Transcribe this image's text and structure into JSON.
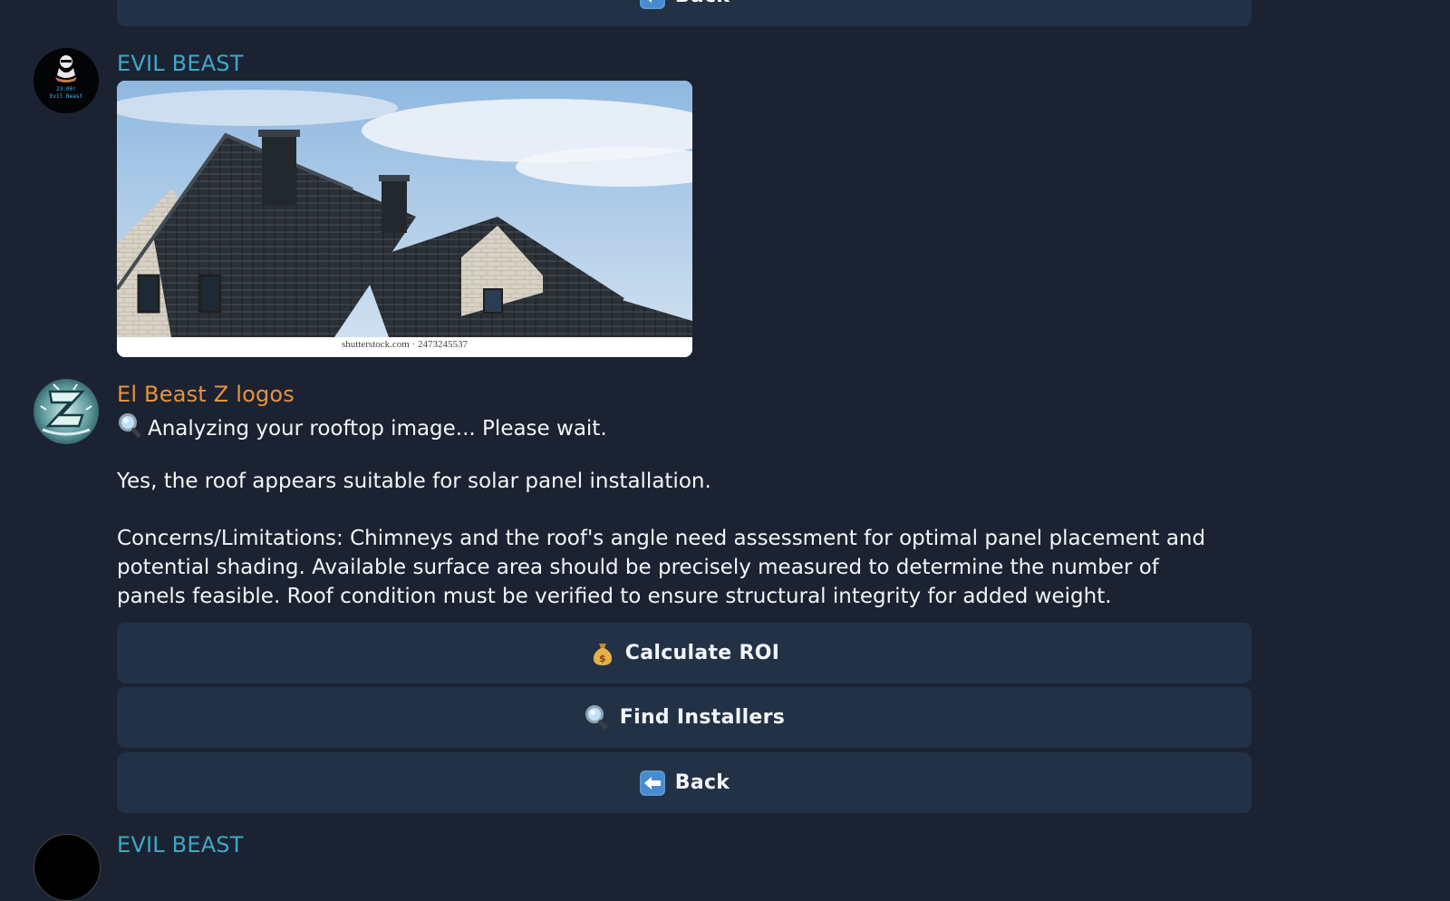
{
  "colors": {
    "background": "#1b2332",
    "button_bg": "#223146",
    "sender_evil_beast": "#40a7c9",
    "sender_logos": "#e8923c",
    "message_text": "#f3f5f8"
  },
  "top_partial": {
    "back_label": "Back",
    "back_icon": "left-arrow-emoji-icon"
  },
  "message1": {
    "sender": "EVIL BEAST",
    "avatar": {
      "icon": "evil-beast-avatar-icon",
      "time_text": "23:00!",
      "name_text": "Evil Beast"
    },
    "photo": {
      "description_icon": "rooftop-photo-image",
      "caption": "shutterstock.com · 2473245537"
    }
  },
  "message2": {
    "sender": "El Beast Z logos",
    "avatar_icon": "el-beast-z-logos-avatar-icon",
    "status_icon": "magnifier-emoji-icon",
    "status_text": "Analyzing your rooftop image... Please wait.",
    "result_line": "Yes, the roof appears suitable for solar panel installation.",
    "concerns_lines": [
      "Concerns/Limitations:  Chimneys and the roof's angle need assessment for optimal panel placement and",
      "potential shading.  Available surface area should be precisely measured to determine the number of",
      "panels feasible.  Roof condition must be verified to ensure structural integrity for added weight."
    ]
  },
  "buttons": [
    {
      "label": "Calculate ROI",
      "icon": "money-bag-emoji-icon"
    },
    {
      "label": "Find Installers",
      "icon": "magnifier-emoji-icon"
    },
    {
      "label": "Back",
      "icon": "left-arrow-emoji-icon"
    }
  ],
  "bottom_partial": {
    "sender": "EVIL BEAST"
  }
}
